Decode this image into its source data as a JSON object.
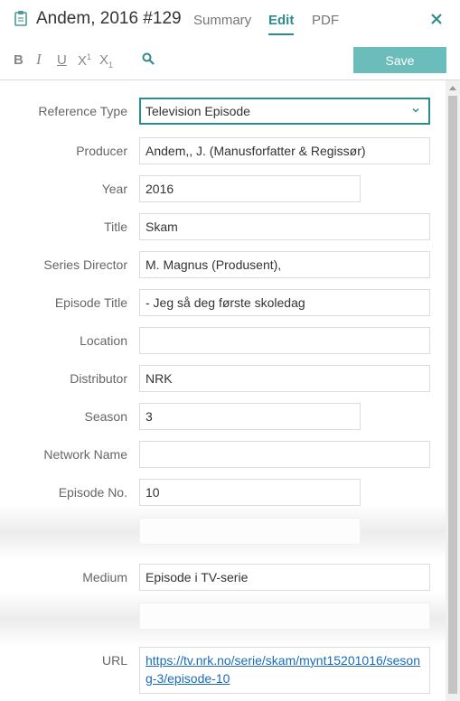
{
  "header": {
    "title": "Andem, 2016 #129",
    "tabs": [
      {
        "label": "Summary",
        "active": false
      },
      {
        "label": "Edit",
        "active": true
      },
      {
        "label": "PDF",
        "active": false
      }
    ],
    "icons": {
      "document": "clipboard-icon",
      "close": "close-icon"
    }
  },
  "toolbar": {
    "bold": "B",
    "italic": "I",
    "underline": "U",
    "superscript_base": "X",
    "superscript_mark": "1",
    "subscript_base": "X",
    "subscript_mark": "1",
    "search_icon": "search-icon",
    "save_label": "Save"
  },
  "form": {
    "reference_type": {
      "label": "Reference Type",
      "value": "Television Episode"
    },
    "producer": {
      "label": "Producer",
      "value": "Andem,, J. (Manusforfatter & Regissør)"
    },
    "year": {
      "label": "Year",
      "value": "2016"
    },
    "title": {
      "label": "Title",
      "value": "Skam"
    },
    "series_director": {
      "label": "Series Director",
      "value": "M. Magnus (Produsent),"
    },
    "episode_title": {
      "label": "Episode Title",
      "value": "- Jeg så deg første skoledag"
    },
    "location": {
      "label": "Location",
      "value": ""
    },
    "distributor": {
      "label": "Distributor",
      "value": "NRK"
    },
    "season": {
      "label": "Season",
      "value": "3"
    },
    "network_name": {
      "label": "Network Name",
      "value": ""
    },
    "episode_no": {
      "label": "Episode No.",
      "value": "10"
    },
    "medium": {
      "label": "Medium",
      "value": "Episode i TV-serie"
    },
    "url": {
      "label": "URL",
      "value": "https://tv.nrk.no/serie/skam/mynt15201016/sesong-3/episode-10"
    }
  },
  "colors": {
    "accent": "#2e8b8b",
    "save_button": "#6bbdbb",
    "link": "#1a6bb8"
  }
}
